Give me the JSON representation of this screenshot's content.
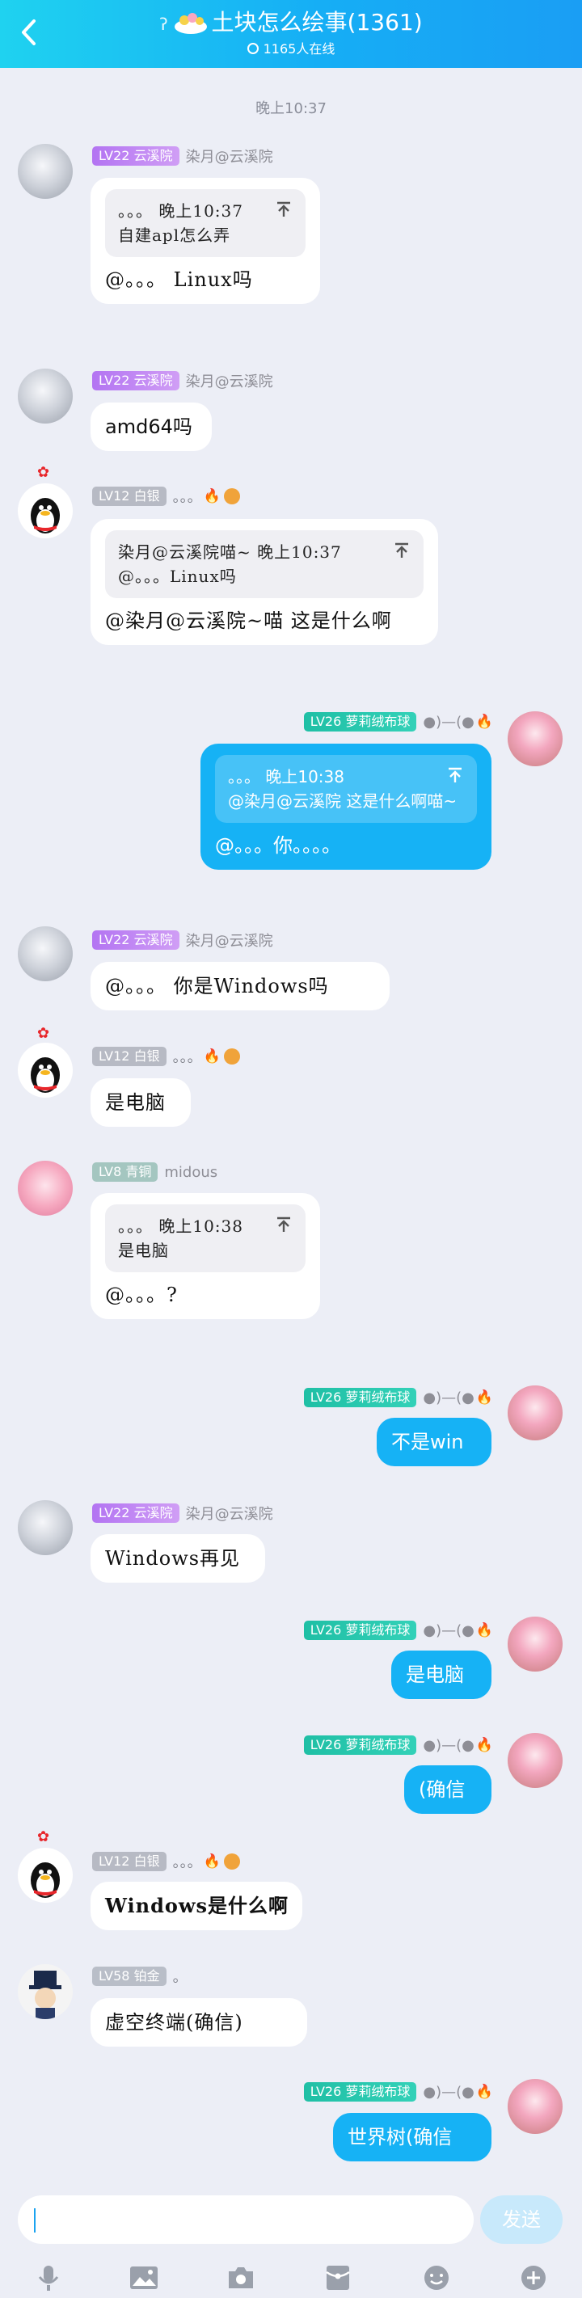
{
  "header": {
    "title": "土块怎么绘事(1361)",
    "online": "1165人在线"
  },
  "timestamp": "晚上10:37",
  "messages": [
    {
      "level": "LV22",
      "title": "云溪院",
      "name": "染月@云溪院",
      "quote_head": "。。。 晚上10:37",
      "quote_text": "自建apl怎么弄",
      "text": "@。。。 Linux吗"
    },
    {
      "level": "LV22",
      "title": "云溪院",
      "name": "染月@云溪院",
      "text": "amd64吗"
    },
    {
      "level": "LV12",
      "title": "白银",
      "name": "。。。",
      "quote_head": "染月@云溪院喵~ 晚上10:37",
      "quote_text": "@。。。Linux吗",
      "text": "@染月@云溪院~喵 这是什么啊"
    },
    {
      "level": "LV26",
      "title": "萝莉绒布球",
      "name": "●)—(●",
      "quote_head": "。。。 晚上10:38",
      "quote_text": "@染月@云溪院 这是什么啊喵~",
      "text": "@。。。你。。。。"
    },
    {
      "level": "LV22",
      "title": "云溪院",
      "name": "染月@云溪院",
      "text": "@。。。 你是Windows吗"
    },
    {
      "level": "LV12",
      "title": "白银",
      "name": "。。。",
      "text": "是电脑"
    },
    {
      "level": "LV8",
      "title": "青铜",
      "name": "midous",
      "quote_head": "。。。 晚上10:38",
      "quote_text": "是电脑",
      "text": "@。。。?"
    },
    {
      "level": "LV26",
      "title": "萝莉绒布球",
      "name": "●)—(●",
      "text": "不是win"
    },
    {
      "level": "LV22",
      "title": "云溪院",
      "name": "染月@云溪院",
      "text": "Windows再见"
    },
    {
      "level": "LV26",
      "title": "萝莉绒布球",
      "name": "●)—(●",
      "text": "是电脑"
    },
    {
      "level": "LV26",
      "title": "萝莉绒布球",
      "name": "●)—(●",
      "text": "(确信"
    },
    {
      "level": "LV12",
      "title": "白银",
      "name": "。。。",
      "text": "Windows是什么啊"
    },
    {
      "level": "LV58",
      "title": "铂金",
      "name": "。",
      "text": "虚空终端(确信)"
    },
    {
      "level": "LV26",
      "title": "萝莉绒布球",
      "name": "●)—(●",
      "text": "世界树(确信"
    }
  ],
  "input": {
    "send_label": "发送"
  },
  "toolbar_icons": [
    "mic-icon",
    "image-icon",
    "camera-icon",
    "red-packet-icon",
    "emoji-icon",
    "plus-icon"
  ],
  "colors": {
    "accent": "#16b2f5",
    "background": "#eceef6"
  }
}
